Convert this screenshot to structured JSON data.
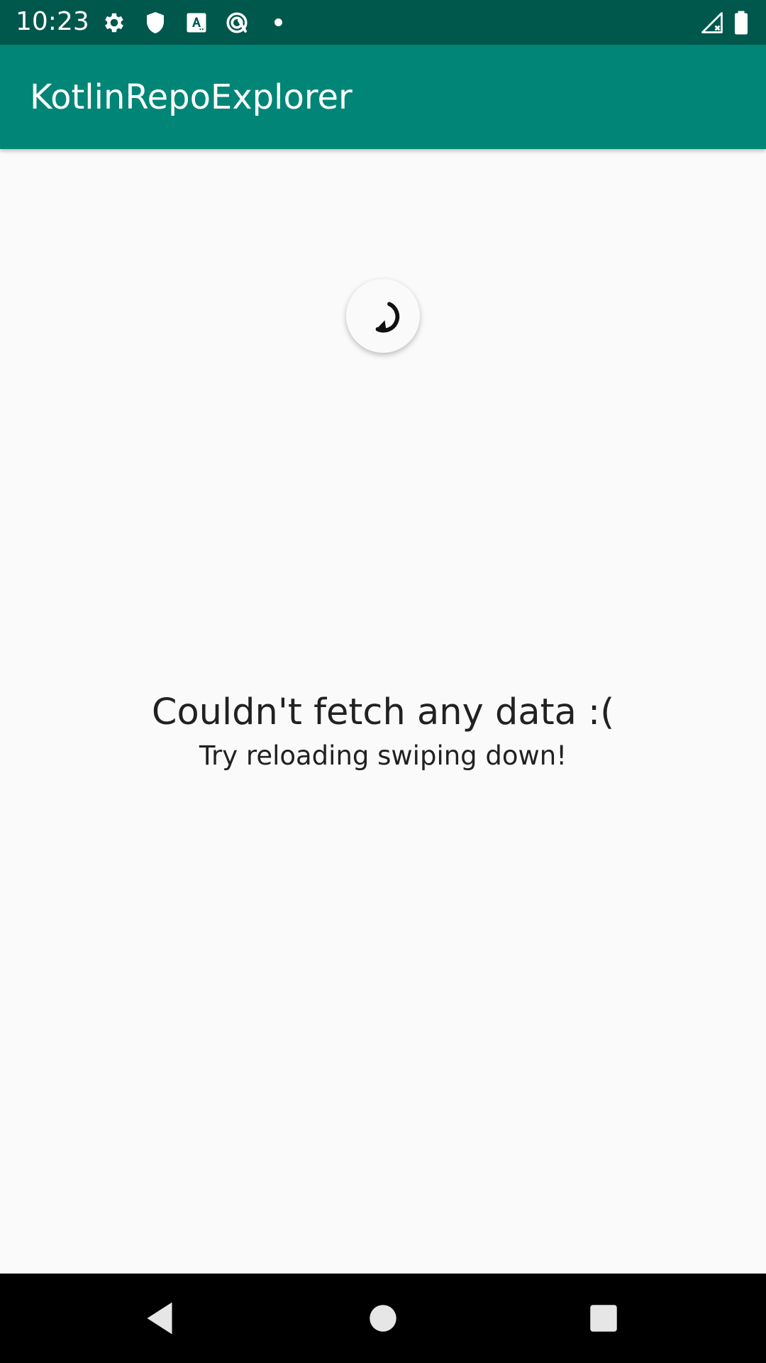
{
  "status_bar": {
    "time": "10:23",
    "icons": [
      "settings-icon",
      "shield-icon",
      "keyboard-a-icon",
      "sync-icon",
      "notification-dot-icon",
      "signal-off-icon",
      "battery-icon"
    ]
  },
  "app_bar": {
    "title": "KotlinRepoExplorer"
  },
  "refresh": {
    "icon": "refresh-icon"
  },
  "empty_state": {
    "title": "Couldn't fetch any data :(",
    "subtitle": "Try reloading swiping down!"
  },
  "nav_bar": {
    "back_icon": "back-icon",
    "home_icon": "home-icon",
    "recents_icon": "recents-icon"
  },
  "colors": {
    "primary": "#008577",
    "primary_dark": "#00574b",
    "background": "#fafafa",
    "text": "#212121"
  }
}
